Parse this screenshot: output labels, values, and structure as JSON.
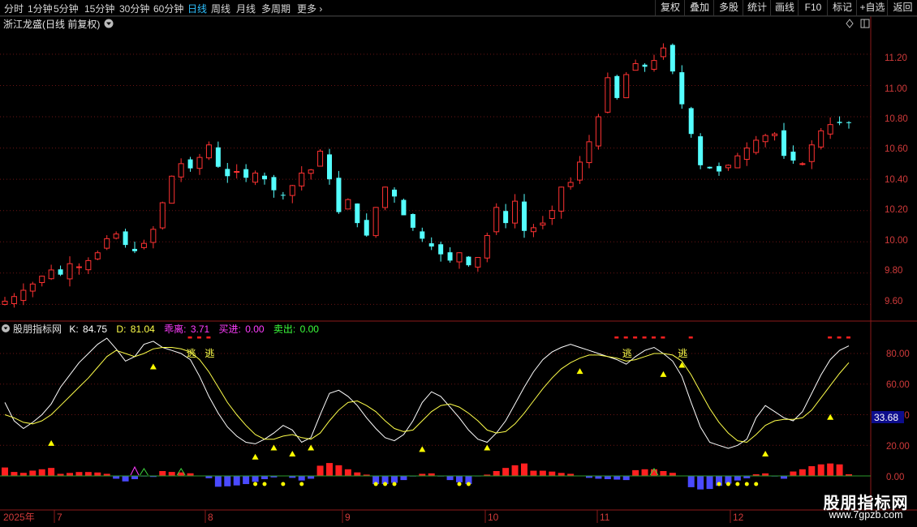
{
  "toolbar": {
    "periods": [
      "分时",
      "1分钟",
      "5分钟",
      "15分钟",
      "30分钟",
      "60分钟",
      "日线",
      "周线",
      "月线",
      "多周期",
      "更多"
    ],
    "active_period": "日线",
    "buttons": [
      "复权",
      "叠加",
      "多股",
      "统计",
      "画线",
      "F10",
      "标记",
      "+自选",
      "返回"
    ]
  },
  "price_panel": {
    "title": "浙江龙盛(日线 前复权)",
    "y_ticks": [
      "11.20",
      "11.00",
      "10.80",
      "10.60",
      "10.40",
      "10.20",
      "10.00",
      "9.80",
      "9.60"
    ]
  },
  "indicator_panel": {
    "name": "股朋指标网",
    "k_label": "K:",
    "k_value": "84.75",
    "d_label": "D:",
    "d_value": "81.04",
    "deviation_label": "乖离:",
    "deviation_value": "3.71",
    "buy_label": "买进:",
    "buy_value": "0.00",
    "sell_label": "卖出:",
    "sell_value": "0.00",
    "y_ticks": [
      "80.00",
      "60.00",
      "40.00",
      "20.00",
      "0.00"
    ],
    "cursor_value": "33.68",
    "escape_label": "逃"
  },
  "x_axis": {
    "labels": [
      "2025年",
      "7",
      "8",
      "9",
      "10",
      "11",
      "12"
    ]
  },
  "watermark": {
    "title": "股朋指标网",
    "url": "www.7gpzb.com"
  },
  "colors": {
    "up_candle": "#ff3232",
    "down_candle": "#54ffff",
    "k_line": "#ffffff",
    "d_line": "#ffff4a",
    "hist_up": "#ff2020",
    "hist_down": "#4a4aff",
    "grid": "#8b1a1a",
    "active_tab": "#2ec1ff"
  },
  "chart_data": {
    "type": "candlestick",
    "price_closes": [
      9.62,
      9.65,
      9.69,
      9.73,
      9.78,
      9.82,
      9.79,
      9.86,
      9.84,
      9.88,
      9.93,
      10.02,
      10.05,
      9.98,
      9.94,
      9.99,
      10.08,
      10.25,
      10.42,
      10.5,
      10.47,
      10.54,
      10.62,
      10.48,
      10.42,
      10.45,
      10.41,
      10.44,
      10.4,
      10.33,
      10.3,
      10.36,
      10.44,
      10.46,
      10.58,
      10.4,
      10.19,
      10.27,
      10.12,
      10.04,
      10.22,
      10.35,
      10.29,
      10.17,
      10.09,
      10.02,
      9.97,
      9.92,
      9.88,
      9.93,
      9.85,
      9.9,
      10.04,
      10.22,
      10.12,
      10.26,
      10.07,
      10.09,
      10.12,
      10.2,
      10.35,
      10.38,
      10.51,
      10.64,
      10.8,
      11.05,
      10.92,
      11.07,
      11.14,
      11.12,
      11.16,
      11.24,
      11.09,
      10.88,
      10.69,
      10.49,
      10.47,
      10.45,
      10.49,
      10.55,
      10.6,
      10.65,
      10.68,
      10.69,
      10.55,
      10.52,
      10.5,
      10.62,
      10.71,
      10.75,
      10.76,
      10.76
    ],
    "kd_series": [
      {
        "name": "K",
        "note": "range 0-100"
      },
      {
        "name": "D",
        "note": "range 0-100"
      }
    ],
    "ylim_price": [
      9.55,
      11.35
    ],
    "ylim_indicator": [
      -10,
      100
    ]
  }
}
